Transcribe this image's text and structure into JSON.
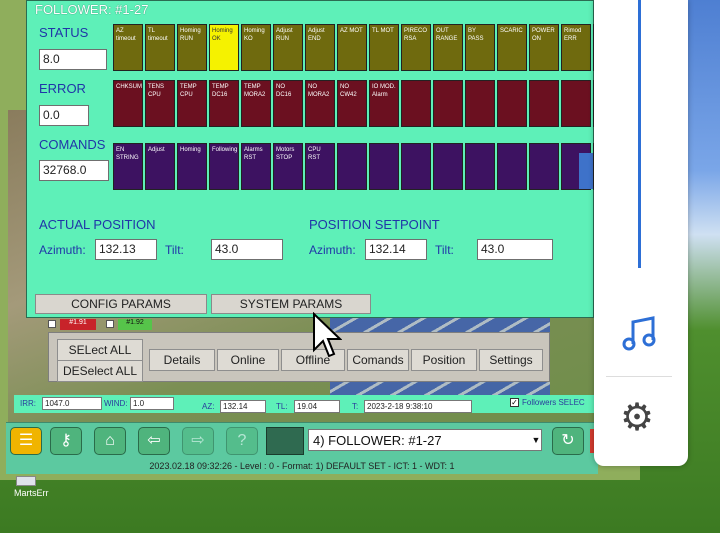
{
  "window": {
    "title": "FOLLOWER: #1-27"
  },
  "status": {
    "label": "STATUS",
    "value": "8.0",
    "flags": [
      "AZ timeout",
      "TL timeout",
      "Homing RUN",
      "Homing OK",
      "Homing KO",
      "Adjust RUN",
      "Adjust END",
      "AZ MOT",
      "TL MOT",
      "PIRECO RSA",
      "OUT RANGE",
      "BY PASS",
      "SCARIC",
      "POWER ON",
      "Rimod ERR",
      ""
    ],
    "active_flag": "Homing OK"
  },
  "error": {
    "label": "ERROR",
    "value": "0.0",
    "flags": [
      "CHKSUM",
      "TENS CPU",
      "TEMP CPU",
      "TEMP DC16",
      "TEMP MORA2",
      "NO DC16",
      "NO MORA2",
      "NO CW42",
      "IO MOD. Alarm",
      "",
      "",
      "",
      "",
      "",
      "",
      ""
    ]
  },
  "comands": {
    "label": "COMANDS",
    "value": "32768.0",
    "flags": [
      "EN STRING",
      "Adjust",
      "Homing",
      "Following",
      "Alarms RST",
      "Motors STOP",
      "CPU RST",
      "",
      "",
      "",
      "",
      "",
      "",
      "",
      "",
      ""
    ]
  },
  "actual_position": {
    "title": "ACTUAL POSITION",
    "azimuth_label": "Azimuth:",
    "azimuth": "132.13",
    "tilt_label": "Tilt:",
    "tilt": "43.0"
  },
  "position_setpoint": {
    "title": "POSITION SETPOINT",
    "azimuth_label": "Azimuth:",
    "azimuth": "132.14",
    "tilt_label": "Tilt:",
    "tilt": "43.0"
  },
  "buttons": {
    "config": "CONFIG PARAMS",
    "system": "SYSTEM PARAMS"
  },
  "select": {
    "all": "SELect ALL",
    "deselect": "DESelect ALL"
  },
  "tags": {
    "red": "#1.91",
    "green": "#1.92"
  },
  "panel_buttons": [
    "Details",
    "Online",
    "Offline",
    "Comands",
    "Position",
    "Settings"
  ],
  "info": {
    "irr_label": "IRR:",
    "irr": "1047.0",
    "wind_label": "WIND:",
    "wind": "1.0",
    "az_label": "AZ:",
    "az": "132.14",
    "tl_label": "TL:",
    "tl": "19.04",
    "t_label": "T:",
    "t": "2023-2-18 9:38:10",
    "followers_label": "Followers SELEC"
  },
  "toolbar": {
    "selector": "4) FOLLOWER: #1-27"
  },
  "statusbar": {
    "text": "2023.02.18    09:32:26 - Level : 0 - Format: 1) DEFAULT SET - ICT: 1 - WDT: 1"
  },
  "desktop": {
    "icon_label": "MartsErr"
  },
  "colors": {
    "window_bg": "#5ef0b8",
    "status_flag": "#6f6a0e",
    "status_flag_on": "#f5f200",
    "error_flag": "#6b1020",
    "command_flag": "#3d1261",
    "label_text": "#2036a8"
  }
}
